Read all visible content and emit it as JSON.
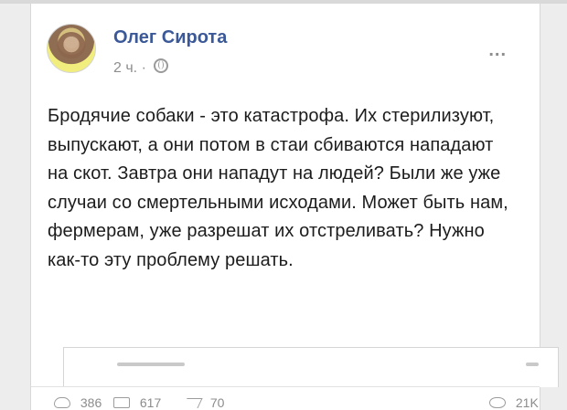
{
  "post": {
    "author": "Олег Сирота",
    "time": "2 ч.",
    "separator": "·",
    "text": "Бродячие собаки - это катастрофа. Их стерилизуют, выпускают, а они потом в стаи сбиваются нападают на скот. Завтра они нападут на людей? Были же уже случаи со смертельными исходами. Может быть нам, фермерам, уже разрешат их отстреливать? Нужно как-то эту проблему решать."
  },
  "actions": {
    "more": "..."
  },
  "stats": {
    "likes": "386",
    "comments": "617",
    "shares": "70",
    "views": "21K"
  },
  "icons": {
    "globe": "globe-icon",
    "like": "heart-icon",
    "comment": "comment-icon",
    "share": "share-icon",
    "views": "eye-icon"
  },
  "colors": {
    "author": "#3b5998",
    "text": "#1c1c1c",
    "meta": "#8e8e8e",
    "background": "#ededed",
    "card": "#ffffff"
  }
}
